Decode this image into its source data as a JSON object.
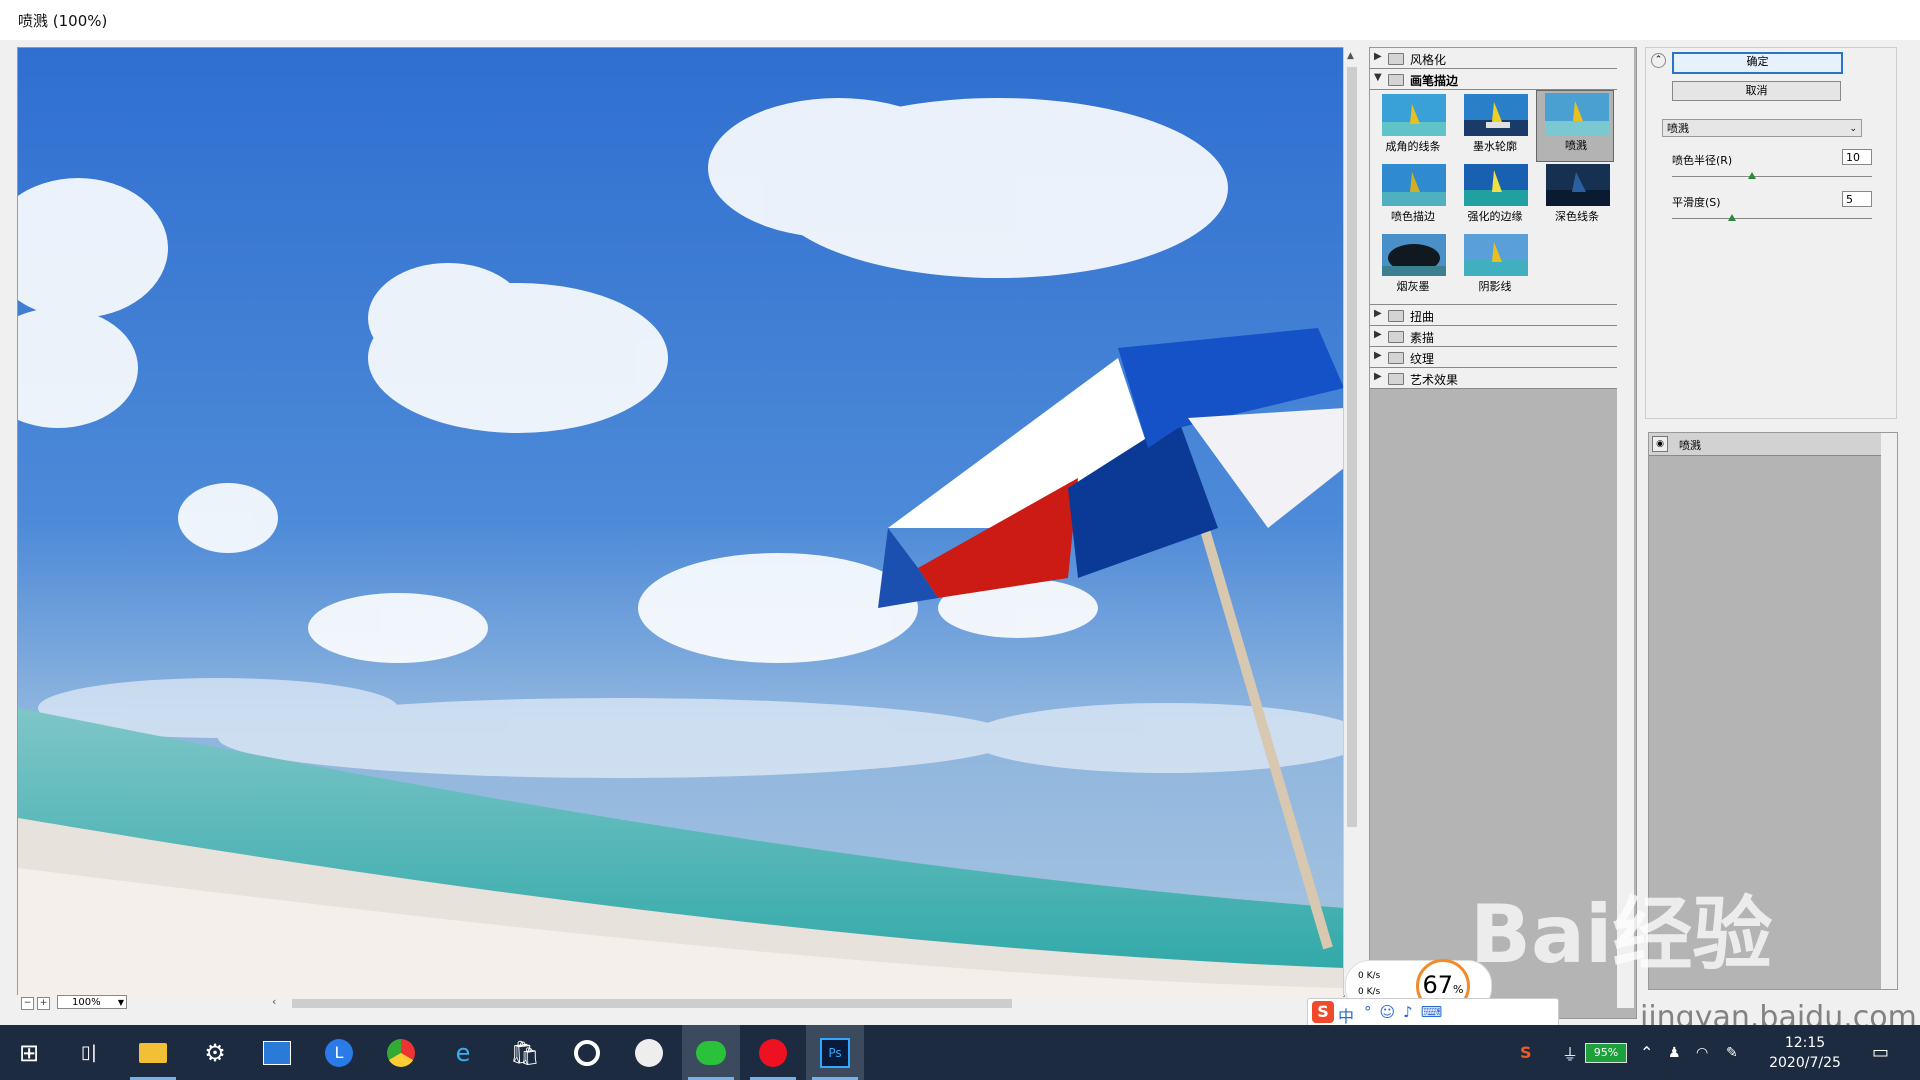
{
  "window": {
    "title": "喷溅 (100%)"
  },
  "preview": {
    "zoom": "100%"
  },
  "gallery": {
    "categories_top": [
      {
        "label": "风格化",
        "expanded": false
      },
      {
        "label": "画笔描边",
        "expanded": true
      }
    ],
    "filters": [
      {
        "label": "成角的线条",
        "selected": false
      },
      {
        "label": "墨水轮廓",
        "selected": false
      },
      {
        "label": "喷溅",
        "selected": true
      },
      {
        "label": "喷色描边",
        "selected": false
      },
      {
        "label": "强化的边缘",
        "selected": false
      },
      {
        "label": "深色线条",
        "selected": false
      },
      {
        "label": "烟灰墨",
        "selected": false
      },
      {
        "label": "阴影线",
        "selected": false
      }
    ],
    "categories_bottom": [
      {
        "label": "扭曲"
      },
      {
        "label": "素描"
      },
      {
        "label": "纹理"
      },
      {
        "label": "艺术效果"
      }
    ]
  },
  "controls": {
    "ok_label": "确定",
    "cancel_label": "取消",
    "filter_select": "喷溅",
    "params": [
      {
        "label": "喷色半径(R)",
        "value": "10",
        "fraction": 0.4
      },
      {
        "label": "平滑度(S)",
        "value": "5",
        "fraction": 0.3
      }
    ]
  },
  "layers": {
    "items": [
      {
        "name": "喷溅"
      }
    ]
  },
  "overlay": {
    "net_up": "0 K/s",
    "net_down": "0 K/s",
    "percent": "67",
    "percent_unit": "%"
  },
  "ime": {
    "lang": "中"
  },
  "taskbar": {
    "battery": "95%",
    "time": "12:15",
    "date": "2020/7/25"
  },
  "watermark": {
    "brand": "Bai经验",
    "url": "jingyan.baidu.com"
  },
  "colors": {
    "accent": "#2a74c8",
    "taskbar": "#1c2b3f",
    "gallery_bg": "#b4b4b4"
  }
}
